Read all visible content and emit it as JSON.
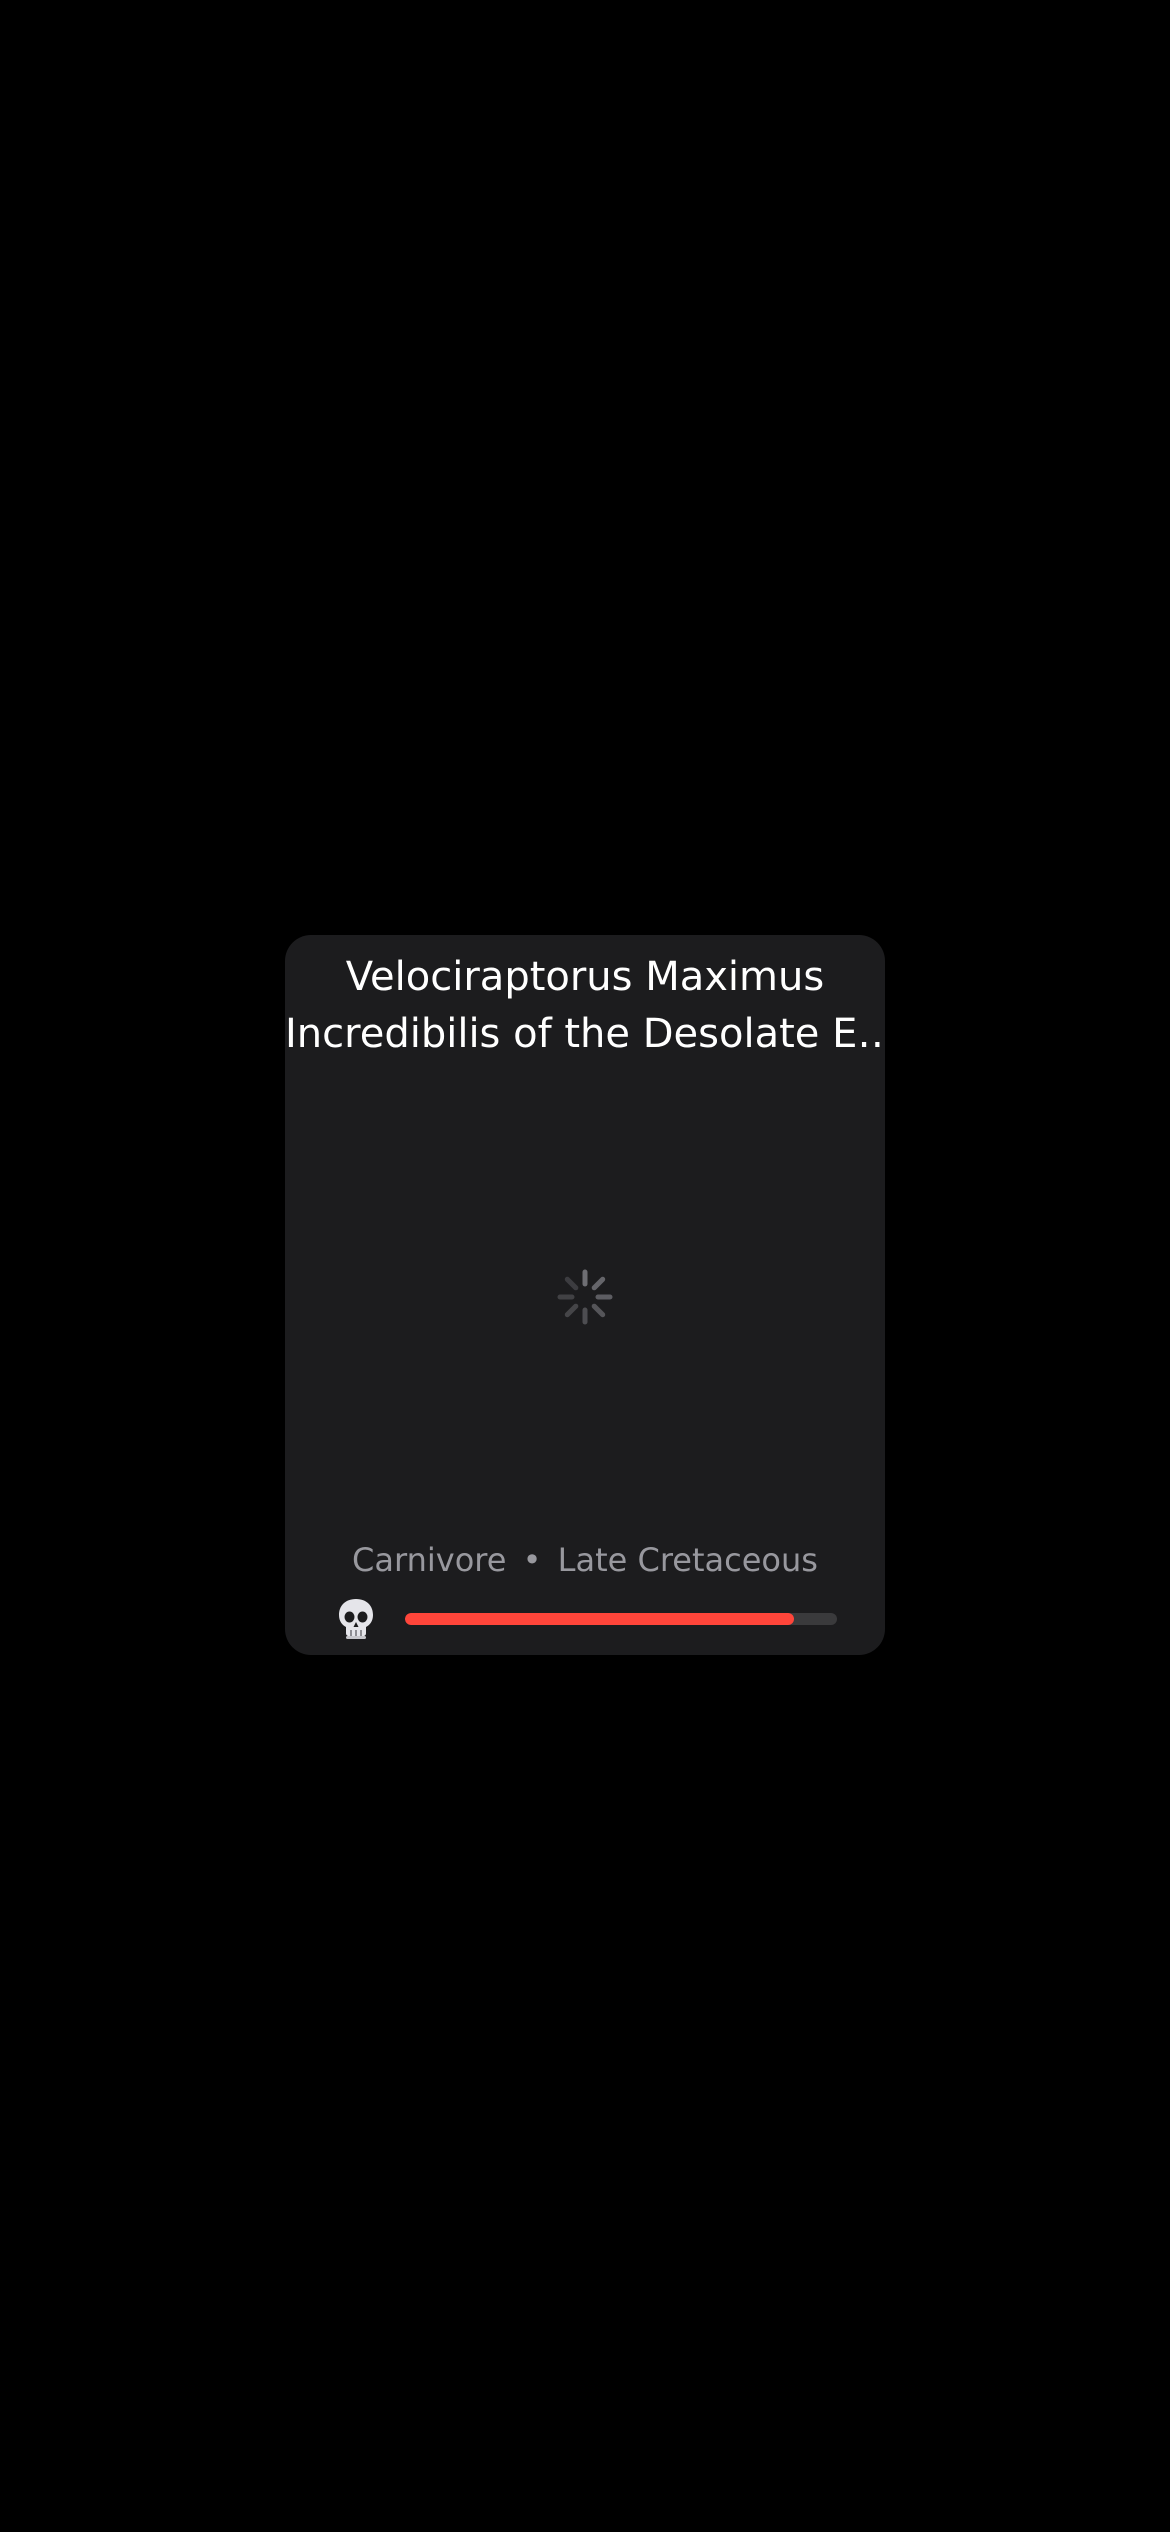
{
  "card": {
    "title_line1": "Velociraptorus Maximus",
    "title_line2": "Incredibilis of the Desolate E…",
    "diet": "Carnivore",
    "separator": "•",
    "period": "Late Cretaceous",
    "status_icon": "skull-icon",
    "loading_icon": "activity-spinner-icon",
    "health": 0.9,
    "colors": {
      "background": "#000000",
      "card": "#1c1c1e",
      "title": "#ffffff",
      "subtitle": "#98989e",
      "bar_track": "#3a3a3c",
      "bar_fill": "#ff453a"
    }
  }
}
